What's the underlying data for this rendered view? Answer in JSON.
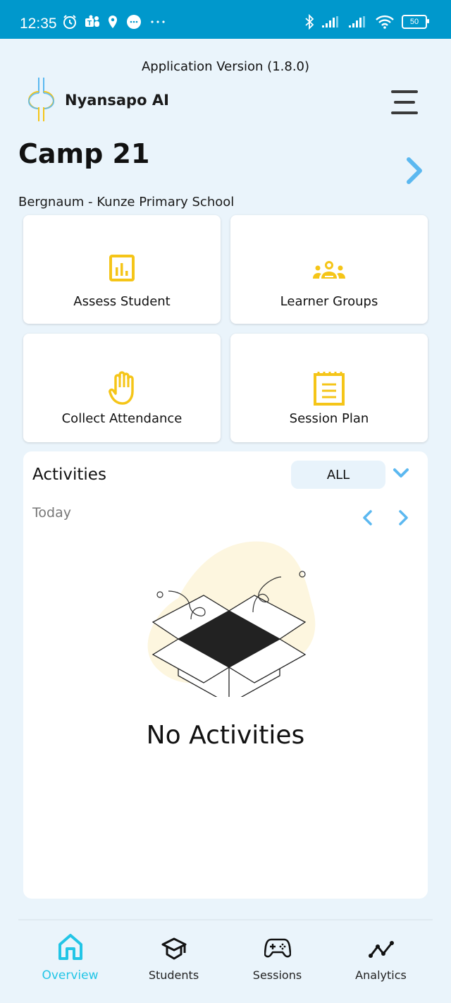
{
  "status_bar": {
    "time": "12:35",
    "left_icons": [
      "alarm-icon",
      "teams-icon",
      "location-icon",
      "chat-bubble-icon",
      "more-dots-icon"
    ],
    "right_icons": [
      "bluetooth-icon",
      "signal-icon",
      "signal-icon",
      "wifi-icon",
      "battery-icon"
    ],
    "battery_level": "50"
  },
  "header": {
    "app_version": "Application Version (1.8.0)",
    "app_name": "Nyansapo AI",
    "menu_icon": "hamburger-menu-icon"
  },
  "camp": {
    "title": "Camp 21",
    "school": "Bergnaum - Kunze Primary School",
    "next_icon": "chevron-right-icon"
  },
  "tiles": [
    {
      "label": "Assess Student",
      "icon": "bar-chart-icon"
    },
    {
      "label": "Learner Groups",
      "icon": "groups-icon"
    },
    {
      "label": "Collect Attendance",
      "icon": "raised-hand-icon"
    },
    {
      "label": "Session Plan",
      "icon": "notepad-icon"
    }
  ],
  "activities": {
    "title": "Activities",
    "filter_value": "ALL",
    "date_label": "Today",
    "empty_message": "No Activities",
    "illustration": "empty-box-illustration"
  },
  "bottom_nav": {
    "items": [
      {
        "label": "Overview",
        "icon": "home-icon",
        "active": true
      },
      {
        "label": "Students",
        "icon": "graduation-cap-icon",
        "active": false
      },
      {
        "label": "Sessions",
        "icon": "gamepad-icon",
        "active": false
      },
      {
        "label": "Analytics",
        "icon": "line-chart-icon",
        "active": false
      }
    ]
  },
  "colors": {
    "status_bar": "#0098cc",
    "background": "#eaf4fb",
    "accent_yellow": "#f5c518",
    "accent_blue": "#5bb8f0",
    "nav_active": "#22c5e6"
  }
}
